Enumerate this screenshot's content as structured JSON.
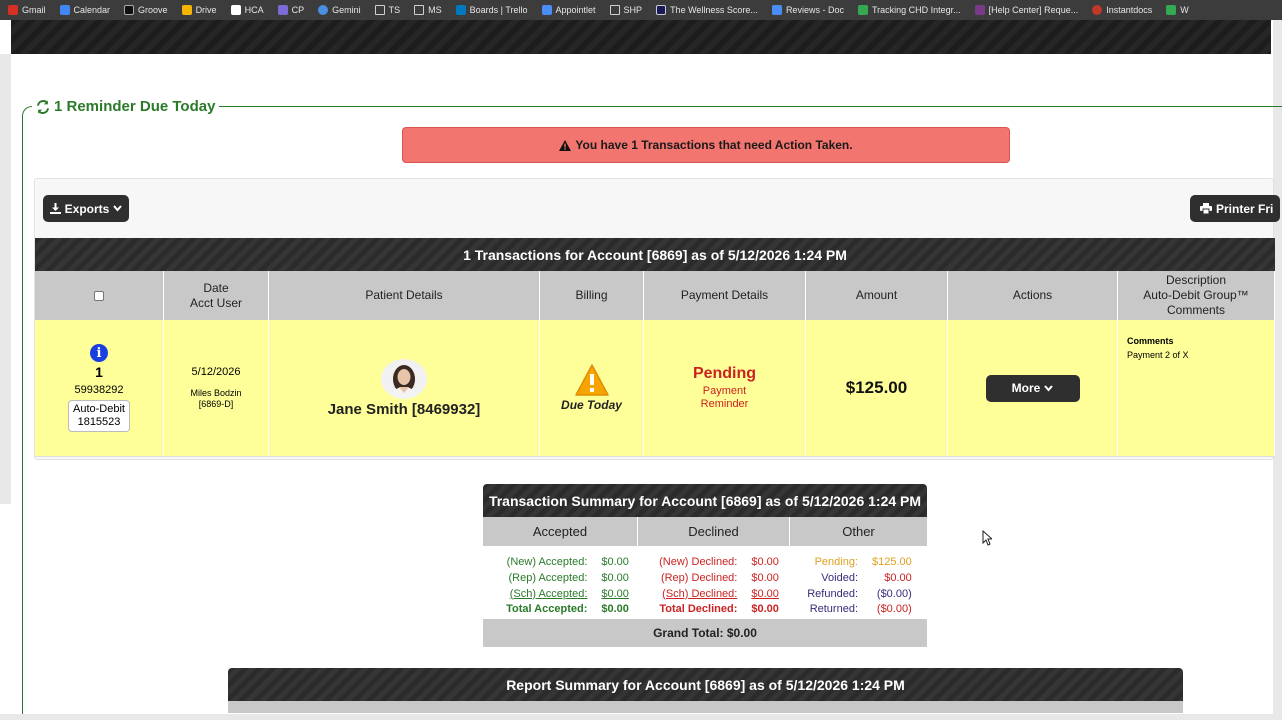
{
  "bookmarks": [
    {
      "label": "Gmail",
      "color": "#d93025"
    },
    {
      "label": "Calendar",
      "color": "#4285f4"
    },
    {
      "label": "Groove",
      "color": "#111111"
    },
    {
      "label": "Drive",
      "color": "#f4b400"
    },
    {
      "label": "HCA",
      "color": "#ffffff"
    },
    {
      "label": "CP",
      "color": "#7b6bd6"
    },
    {
      "label": "Gemini",
      "color": "#4a90e2"
    },
    {
      "label": "TS",
      "color": "folder"
    },
    {
      "label": "MS",
      "color": "folder"
    },
    {
      "label": "Boards | Trello",
      "color": "#0079bf"
    },
    {
      "label": "Appointlet",
      "color": "#4a8df6"
    },
    {
      "label": "SHP",
      "color": "folder"
    },
    {
      "label": "The Wellness Score...",
      "color": "#1a1a5a"
    },
    {
      "label": "Reviews - Doc",
      "color": "#4a8df6"
    },
    {
      "label": "Tracking CHD Integr...",
      "color": "#34a853"
    },
    {
      "label": "[Help Center] Reque...",
      "color": "#7a3a8a"
    },
    {
      "label": "Instantdocs",
      "color": "#c0392b"
    },
    {
      "label": "W",
      "color": "#34a853"
    }
  ],
  "legend": {
    "title": "1 Reminder Due Today"
  },
  "alert": {
    "text": "You have 1 Transactions that need Action Taken."
  },
  "toolbar": {
    "exports_label": "Exports",
    "printer_label": "Printer Fri"
  },
  "transactions": {
    "title": "1 Transactions for Account [6869] as of 5/12/2026 1:24 PM",
    "columns": {
      "date": "Date",
      "acct_user": "Acct User",
      "patient": "Patient Details",
      "billing": "Billing",
      "payment": "Payment Details",
      "amount": "Amount",
      "actions": "Actions",
      "desc1": "Description",
      "desc2": "Auto-Debit Group™",
      "desc3": "Comments"
    },
    "row": {
      "number": "1",
      "id": "59938292",
      "badge_line1": "Auto-Debit",
      "badge_line2": "1815523",
      "date": "5/12/2026",
      "user": "Miles Bodzin",
      "user_code": "[6869-D]",
      "patient": "Jane Smith [8469932]",
      "billing": "Due Today",
      "status": "Pending",
      "payment_line1": "Payment",
      "payment_line2": "Reminder",
      "amount": "$125.00",
      "more_label": "More",
      "comments_title": "Comments",
      "comments_text": "Payment 2 of X"
    }
  },
  "summary": {
    "title": "Transaction Summary for Account [6869] as of 5/12/2026 1:24 PM",
    "columns": {
      "accepted": "Accepted",
      "declined": "Declined",
      "other": "Other"
    },
    "accepted": [
      {
        "label": "(New) Accepted:",
        "value": "$0.00"
      },
      {
        "label": "(Rep) Accepted:",
        "value": "$0.00"
      },
      {
        "label": "(Sch) Accepted:",
        "value": "$0.00"
      },
      {
        "label": "Total Accepted:",
        "value": "$0.00"
      }
    ],
    "declined": [
      {
        "label": "(New) Declined:",
        "value": "$0.00"
      },
      {
        "label": "(Rep) Declined:",
        "value": "$0.00"
      },
      {
        "label": "(Sch) Declined:",
        "value": "$0.00"
      },
      {
        "label": "Total Declined:",
        "value": "$0.00"
      }
    ],
    "other": [
      {
        "label": "Pending:",
        "value": "$125.00"
      },
      {
        "label": "Voided:",
        "value": "$0.00"
      },
      {
        "label": "Refunded:",
        "value": "($0.00)"
      },
      {
        "label": "Returned:",
        "value": "($0.00)"
      }
    ],
    "grand_total": "Grand Total: $0.00"
  },
  "report": {
    "title": "Report Summary for Account [6869] as of 5/12/2026 1:24 PM"
  }
}
